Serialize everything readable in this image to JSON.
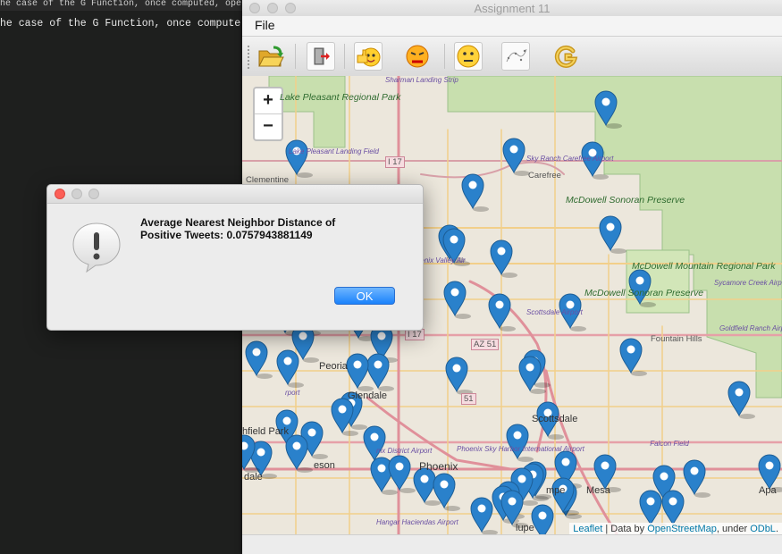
{
  "editor": {
    "tab_text": "he case of the G Function, once computed, ope",
    "code_line": "he case of the G Function, once compute"
  },
  "window": {
    "title": "Assignment 11",
    "menu": {
      "file": "File"
    },
    "toolbar": {
      "buttons": [
        "open-folder",
        "exit",
        "positive-tweets",
        "negative-tweets",
        "neutral-tweets",
        "nearest-neighbor",
        "g-function"
      ]
    }
  },
  "map": {
    "zoom_in": "+",
    "zoom_out": "−",
    "attribution": {
      "leaflet": "Leaflet",
      "sep1": " | Data by ",
      "osm": "OpenStreetMap",
      "sep2": ", under ",
      "odbl": "ODbL",
      "end": "."
    },
    "labels": {
      "lake_pleasant": "Lake Pleasant Regional Park",
      "sharman": "Sharman Landing Strip",
      "lake_pleasant_field": "Lake Pleasant Landing Field",
      "clementine": "Clementine",
      "i17": "I 17",
      "i17b": "I 17",
      "sky_ranch": "Sky Ranch Carefree Airport",
      "carefree": "Carefree",
      "mcdowell_preserve_1": "McDowell Sonoran Preserve",
      "mcdowell_mountain": "McDowell Mountain Regional Park",
      "mcdowell_preserve_2": "McDowell Sonoran Preserve",
      "sycamore": "Sycamore Creek Airport",
      "scottsdale_airport": "Scottsdale Airport",
      "fountain_hills": "Fountain Hills",
      "goldfield": "Goldfield Ranch Airport",
      "az51": "AZ 51",
      "peoria": "Peoria",
      "glendale": "Glendale",
      "scottsdale": "Scottsdale",
      "litchfield": "hfield Park",
      "falcon": "Falcon Field",
      "phoenix": "Phoenix",
      "phoenix_district": "nix District Airport",
      "sky_harbor": "Phoenix Sky Harbor International Airport",
      "tempe": "mpe",
      "mesa": "Mesa",
      "apache": "Apa",
      "hangar": "Hangar Haciendas Airport",
      "lupe": "lupe",
      "nix_valley": "hoenix Valley Air",
      "eson": "eson",
      "dale": "dale",
      "irport": "rport",
      "r51": "51"
    }
  },
  "dialog": {
    "message_line1": "Average Nearest Neighbor Distance of",
    "message_line2": "Positive Tweets: 0.0757943881149",
    "ok_label": "OK"
  },
  "colors": {
    "marker": "#2a81cb",
    "park": "#c8dfae",
    "ok_button": "#1a82fb"
  }
}
